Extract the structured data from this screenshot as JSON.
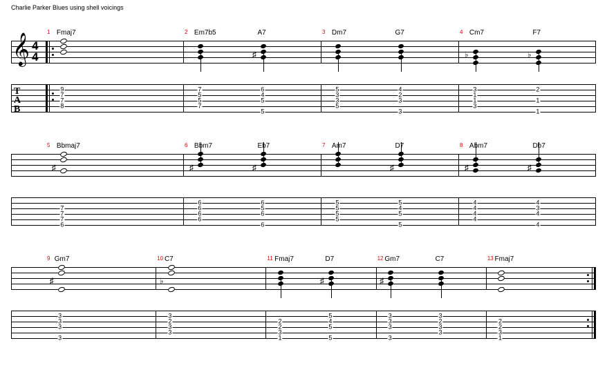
{
  "title": "Charlie Parker Blues using shell voicings",
  "timesig_top": "4",
  "timesig_bot": "4",
  "tab_letters": [
    "T",
    "A",
    "B"
  ],
  "systems": [
    {
      "show_clef": true,
      "show_tab_label": true,
      "repeat_start": true,
      "repeat_end": false,
      "measures": [
        {
          "num": "1",
          "chords": [
            "Fmaj7",
            ""
          ],
          "beats": [
            {
              "notes": [
                {
                  "pos": "lp0",
                  "open": true
                },
                {
                  "pos": "lp1",
                  "open": true
                },
                {
                  "pos": "lp2",
                  "open": true
                }
              ],
              "tab": [
                {
                  "s": "s2",
                  "f": "9"
                },
                {
                  "s": "s3",
                  "f": "7"
                },
                {
                  "s": "s4",
                  "f": "7"
                },
                {
                  "s": "s5",
                  "f": "8"
                }
              ]
            }
          ]
        },
        {
          "num": "2",
          "chords": [
            "Em7b5",
            "A7"
          ],
          "beats": [
            {
              "notes": [
                {
                  "pos": "lp1"
                },
                {
                  "pos": "lp2"
                },
                {
                  "pos": "lp3"
                }
              ],
              "stem": "down",
              "tab": [
                {
                  "s": "s2",
                  "f": "7"
                },
                {
                  "s": "s3",
                  "f": "5"
                },
                {
                  "s": "s4",
                  "f": "5"
                },
                {
                  "s": "s5",
                  "f": "7"
                }
              ]
            },
            {
              "notes": [
                {
                  "pos": "lp1"
                },
                {
                  "pos": "lp2"
                },
                {
                  "pos": "lp3"
                }
              ],
              "acc": "♯",
              "stem": "down",
              "tab": [
                {
                  "s": "s2",
                  "f": "6"
                },
                {
                  "s": "s3",
                  "f": "4"
                },
                {
                  "s": "s4",
                  "f": "5"
                },
                {
                  "s": "s6",
                  "f": "5"
                }
              ]
            }
          ]
        },
        {
          "num": "3",
          "chords": [
            "Dm7",
            "G7"
          ],
          "beats": [
            {
              "notes": [
                {
                  "pos": "lp1"
                },
                {
                  "pos": "lp2"
                },
                {
                  "pos": "lp3"
                }
              ],
              "stem": "down",
              "tab": [
                {
                  "s": "s2",
                  "f": "5"
                },
                {
                  "s": "s3",
                  "f": "3"
                },
                {
                  "s": "s4",
                  "f": "3"
                },
                {
                  "s": "s5",
                  "f": "5"
                }
              ]
            },
            {
              "notes": [
                {
                  "pos": "lp1"
                },
                {
                  "pos": "lp2"
                },
                {
                  "pos": "lp3"
                }
              ],
              "stem": "down",
              "tab": [
                {
                  "s": "s2",
                  "f": "4"
                },
                {
                  "s": "s3",
                  "f": "2"
                },
                {
                  "s": "s4",
                  "f": "3"
                },
                {
                  "s": "s6",
                  "f": "3"
                }
              ]
            }
          ]
        },
        {
          "num": "4",
          "chords": [
            "Cm7",
            "F7"
          ],
          "beats": [
            {
              "notes": [
                {
                  "pos": "lp2"
                },
                {
                  "pos": "lp3"
                },
                {
                  "pos": "lp4"
                }
              ],
              "acc": "♭",
              "stem": "down",
              "tab": [
                {
                  "s": "s2",
                  "f": "3"
                },
                {
                  "s": "s3",
                  "f": "1"
                },
                {
                  "s": "s4",
                  "f": "1"
                },
                {
                  "s": "s5",
                  "f": "3"
                }
              ]
            },
            {
              "notes": [
                {
                  "pos": "lp2"
                },
                {
                  "pos": "lp3"
                },
                {
                  "pos": "lp4"
                }
              ],
              "acc": "♭",
              "stem": "down",
              "tab": [
                {
                  "s": "s2",
                  "f": "2"
                },
                {
                  "s": "s4",
                  "f": "1"
                },
                {
                  "s": "s6",
                  "f": "1"
                }
              ]
            }
          ]
        }
      ]
    },
    {
      "show_clef": false,
      "show_tab_label": false,
      "repeat_start": false,
      "repeat_end": false,
      "measures": [
        {
          "num": "5",
          "chords": [
            "Bbmaj7",
            ""
          ],
          "beats": [
            {
              "notes": [
                {
                  "pos": "lp0",
                  "open": true
                },
                {
                  "pos": "lp1",
                  "open": true
                },
                {
                  "pos": "lp3",
                  "open": true
                }
              ],
              "acc": "♯",
              "tab": [
                {
                  "s": "s3",
                  "f": "7"
                },
                {
                  "s": "s4",
                  "f": "7"
                },
                {
                  "s": "s5",
                  "f": "7"
                },
                {
                  "s": "s6",
                  "f": "6"
                }
              ]
            }
          ]
        },
        {
          "num": "6",
          "chords": [
            "Bbm7",
            "Eb7"
          ],
          "beats": [
            {
              "notes": [
                {
                  "pos": "lp0"
                },
                {
                  "pos": "lp1"
                },
                {
                  "pos": "lp2"
                }
              ],
              "acc": "♯",
              "stem": "up",
              "tab": [
                {
                  "s": "s2",
                  "f": "6"
                },
                {
                  "s": "s3",
                  "f": "6"
                },
                {
                  "s": "s4",
                  "f": "6"
                },
                {
                  "s": "s5",
                  "f": "6"
                }
              ]
            },
            {
              "notes": [
                {
                  "pos": "lp0"
                },
                {
                  "pos": "lp1"
                },
                {
                  "pos": "lp2"
                }
              ],
              "acc": "♯",
              "stem": "up",
              "tab": [
                {
                  "s": "s2",
                  "f": "6"
                },
                {
                  "s": "s3",
                  "f": "5"
                },
                {
                  "s": "s4",
                  "f": "6"
                },
                {
                  "s": "s6",
                  "f": "6"
                }
              ]
            }
          ]
        },
        {
          "num": "7",
          "chords": [
            "Am7",
            "D7"
          ],
          "beats": [
            {
              "notes": [
                {
                  "pos": "lp0"
                },
                {
                  "pos": "lp1"
                },
                {
                  "pos": "lp2"
                }
              ],
              "stem": "up",
              "tab": [
                {
                  "s": "s2",
                  "f": "5"
                },
                {
                  "s": "s3",
                  "f": "5"
                },
                {
                  "s": "s4",
                  "f": "5"
                },
                {
                  "s": "s5",
                  "f": "5"
                }
              ]
            },
            {
              "notes": [
                {
                  "pos": "lp0"
                },
                {
                  "pos": "lp1"
                },
                {
                  "pos": "lp2"
                }
              ],
              "acc": "♯",
              "stem": "up",
              "tab": [
                {
                  "s": "s2",
                  "f": "5"
                },
                {
                  "s": "s3",
                  "f": "4"
                },
                {
                  "s": "s4",
                  "f": "5"
                },
                {
                  "s": "s6",
                  "f": "5"
                }
              ]
            }
          ]
        },
        {
          "num": "8",
          "chords": [
            "Abm7",
            "Db7"
          ],
          "beats": [
            {
              "notes": [
                {
                  "pos": "lp1"
                },
                {
                  "pos": "lp2"
                },
                {
                  "pos": "lp3"
                }
              ],
              "acc": "♯",
              "stem": "up",
              "tab": [
                {
                  "s": "s2",
                  "f": "4"
                },
                {
                  "s": "s3",
                  "f": "4"
                },
                {
                  "s": "s4",
                  "f": "4"
                },
                {
                  "s": "s5",
                  "f": "4"
                }
              ]
            },
            {
              "notes": [
                {
                  "pos": "lp1"
                },
                {
                  "pos": "lp2"
                },
                {
                  "pos": "lp3"
                }
              ],
              "acc": "♯",
              "stem": "up",
              "tab": [
                {
                  "s": "s2",
                  "f": "4"
                },
                {
                  "s": "s3",
                  "f": "3"
                },
                {
                  "s": "s4",
                  "f": "4"
                },
                {
                  "s": "s6",
                  "f": "4"
                }
              ]
            }
          ]
        }
      ]
    },
    {
      "show_clef": false,
      "show_tab_label": false,
      "repeat_start": false,
      "repeat_end": true,
      "measures": [
        {
          "num": "9",
          "chords": [
            "Gm7",
            ""
          ],
          "beats": [
            {
              "notes": [
                {
                  "pos": "lp0",
                  "open": true
                },
                {
                  "pos": "lp1",
                  "open": true
                },
                {
                  "pos": "lp4",
                  "open": true
                }
              ],
              "acc": "♯",
              "tab": [
                {
                  "s": "s2",
                  "f": "3"
                },
                {
                  "s": "s3",
                  "f": "3"
                },
                {
                  "s": "s4",
                  "f": "3"
                },
                {
                  "s": "s6",
                  "f": "3"
                }
              ]
            }
          ]
        },
        {
          "num": "10",
          "chords": [
            "C7",
            ""
          ],
          "beats": [
            {
              "notes": [
                {
                  "pos": "lp0",
                  "open": true
                },
                {
                  "pos": "lp1",
                  "open": true
                },
                {
                  "pos": "lp4",
                  "open": true
                }
              ],
              "acc": "♭",
              "tab": [
                {
                  "s": "s2",
                  "f": "3"
                },
                {
                  "s": "s3",
                  "f": "2"
                },
                {
                  "s": "s4",
                  "f": "3"
                },
                {
                  "s": "s5",
                  "f": "3"
                }
              ]
            }
          ]
        },
        {
          "num": "11",
          "chords": [
            "Fmaj7",
            "D7"
          ],
          "beats": [
            {
              "notes": [
                {
                  "pos": "lp1"
                },
                {
                  "pos": "lp2"
                },
                {
                  "pos": "lp3"
                }
              ],
              "stem": "down",
              "tab": [
                {
                  "s": "s3",
                  "f": "2"
                },
                {
                  "s": "s4",
                  "f": "2"
                },
                {
                  "s": "s5",
                  "f": "3"
                },
                {
                  "s": "s6",
                  "f": "1"
                }
              ]
            },
            {
              "notes": [
                {
                  "pos": "lp1"
                },
                {
                  "pos": "lp2"
                },
                {
                  "pos": "lp3"
                }
              ],
              "acc": "♯",
              "stem": "down",
              "tab": [
                {
                  "s": "s2",
                  "f": "5"
                },
                {
                  "s": "s3",
                  "f": "4"
                },
                {
                  "s": "s4",
                  "f": "5"
                },
                {
                  "s": "s6",
                  "f": "5"
                }
              ]
            }
          ]
        },
        {
          "num": "12",
          "chords": [
            "Gm7",
            "C7"
          ],
          "beats": [
            {
              "notes": [
                {
                  "pos": "lp1"
                },
                {
                  "pos": "lp2"
                },
                {
                  "pos": "lp3"
                }
              ],
              "acc": "♯",
              "stem": "down",
              "tab": [
                {
                  "s": "s2",
                  "f": "3"
                },
                {
                  "s": "s3",
                  "f": "3"
                },
                {
                  "s": "s4",
                  "f": "3"
                },
                {
                  "s": "s6",
                  "f": "3"
                }
              ]
            },
            {
              "notes": [
                {
                  "pos": "lp1"
                },
                {
                  "pos": "lp2"
                },
                {
                  "pos": "lp3"
                }
              ],
              "stem": "down",
              "tab": [
                {
                  "s": "s2",
                  "f": "3"
                },
                {
                  "s": "s3",
                  "f": "2"
                },
                {
                  "s": "s4",
                  "f": "3"
                },
                {
                  "s": "s5",
                  "f": "3"
                }
              ]
            }
          ]
        },
        {
          "num": "13",
          "chords": [
            "Fmaj7",
            ""
          ],
          "beats": [
            {
              "notes": [
                {
                  "pos": "lp1",
                  "open": true
                },
                {
                  "pos": "lp2",
                  "open": true
                },
                {
                  "pos": "lp4",
                  "open": true
                }
              ],
              "tab": [
                {
                  "s": "s3",
                  "f": "2"
                },
                {
                  "s": "s4",
                  "f": "2"
                },
                {
                  "s": "s5",
                  "f": "3"
                },
                {
                  "s": "s6",
                  "f": "1"
                }
              ]
            }
          ]
        }
      ]
    }
  ]
}
